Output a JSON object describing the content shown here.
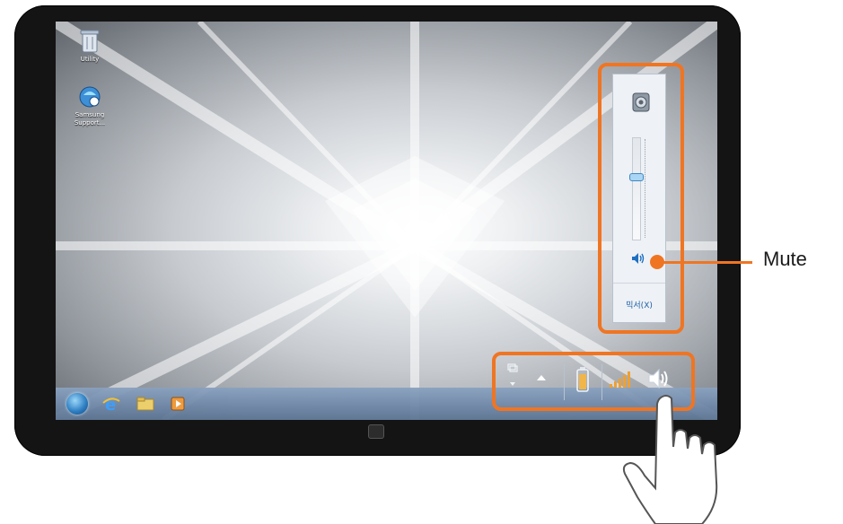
{
  "desktop": {
    "icons": [
      {
        "name": "recycle-bin-icon",
        "label": "Utility"
      },
      {
        "name": "samsung-support-icon",
        "label": "Samsung Support..."
      }
    ]
  },
  "volume_flyout": {
    "device_icon": "speaker-device-icon",
    "volume_level": 0.62,
    "mute_icon": "speaker-sound-on-icon",
    "mixer_label": "믹서(X)"
  },
  "taskbar": {
    "start": "windows-start-orb",
    "pinned": [
      "internet-explorer-icon",
      "file-explorer-icon",
      "media-player-icon"
    ]
  },
  "tray": {
    "items": [
      "action-center-icon",
      "show-hidden-icons-icon",
      "battery-icon",
      "network-signal-icon",
      "volume-icon"
    ]
  },
  "callout": {
    "label": "Mute",
    "color": "#f07522"
  },
  "gesture": "hand-pointer-icon"
}
